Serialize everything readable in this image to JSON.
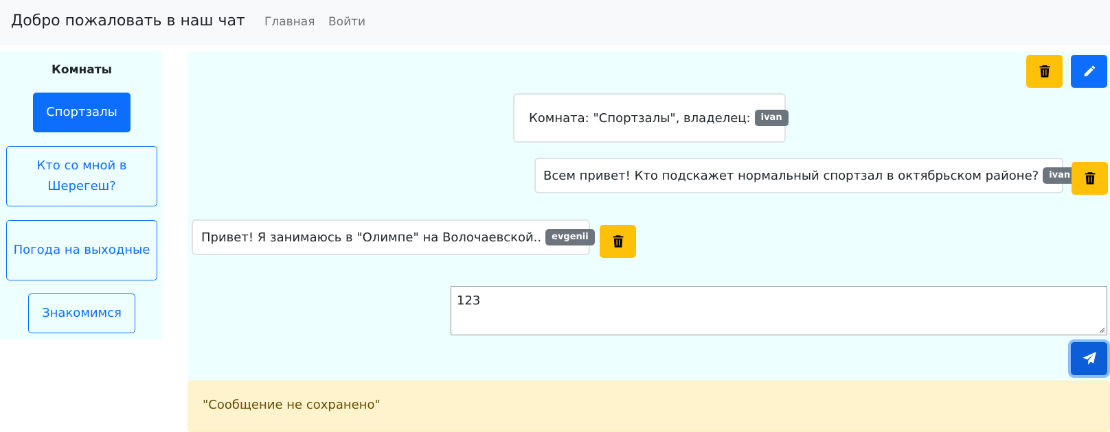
{
  "navbar": {
    "brand": "Добро пожаловать в наш чат",
    "links": [
      "Главная",
      "Войти"
    ]
  },
  "sidebar": {
    "title": "Комнаты",
    "rooms": [
      {
        "label": "Спортзалы",
        "active": true
      },
      {
        "label": "Кто со мной в Шерегеш?",
        "active": false
      },
      {
        "label": "Погода на выходные",
        "active": false
      },
      {
        "label": "Знакомимся",
        "active": false
      }
    ]
  },
  "chat": {
    "room_info": {
      "text": "Комната: \"Спортзалы\", владелец:",
      "owner": "ivan"
    },
    "messages": [
      {
        "text": "Всем привет! Кто подскажет нормальный спортзал в октябрьском районе?",
        "author": "ivan"
      },
      {
        "text": "Привет! Я занимаюсь в \"Олимпе\" на Волочаевской..",
        "author": "evgenii"
      }
    ],
    "input": {
      "value": "123"
    }
  },
  "alert": {
    "text": "\"Сообщение не сохранено\""
  },
  "icons": {
    "delete": "trash-icon",
    "edit": "pencil-icon",
    "send": "send-icon"
  },
  "colors": {
    "primary": "#0d6efd",
    "warning": "#ffc107",
    "badge": "#6c757d",
    "panel_bg": "#eeffff",
    "alert_bg": "#fff3cd",
    "alert_text": "#664d03"
  }
}
